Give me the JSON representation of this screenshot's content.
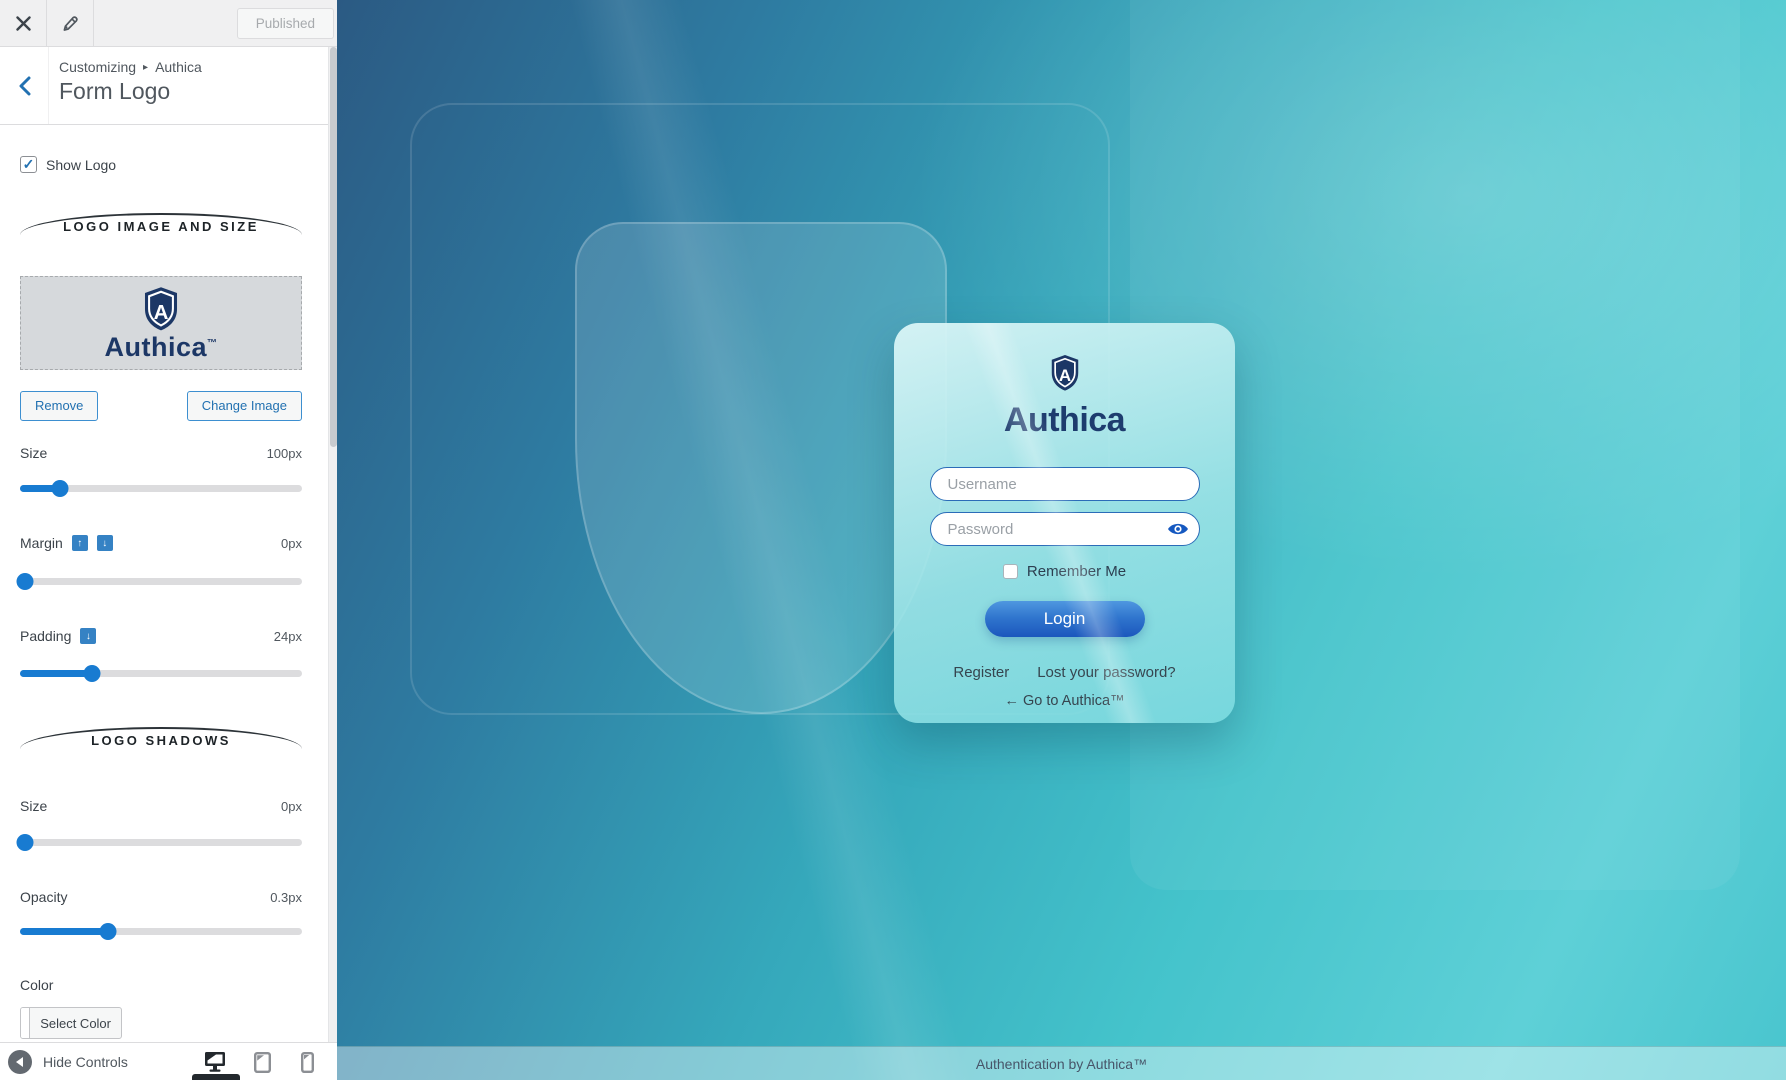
{
  "customizer": {
    "topbar": {
      "publish_label": "Published"
    },
    "header": {
      "breadcrumb": {
        "part1": "Customizing",
        "separator": "▸",
        "part2": "Authica"
      },
      "title": "Form Logo"
    },
    "show_logo": {
      "label": "Show Logo",
      "checkmark": "✓"
    },
    "sections": {
      "image_size": "LOGO IMAGE AND SIZE",
      "shadows": "LOGO SHADOWS"
    },
    "logo_preview": {
      "brand": "Authica",
      "tm": "™"
    },
    "buttons": {
      "remove": "Remove",
      "change_image": "Change Image"
    },
    "icons": {
      "up_arrow": "↑",
      "down_arrow": "↓"
    },
    "controls": {
      "size": {
        "label": "Size",
        "value": "100px",
        "percent": 14
      },
      "margin": {
        "label": "Margin",
        "value": "0px",
        "percent": 1.5
      },
      "padding": {
        "label": "Padding",
        "value": "24px",
        "percent": 25
      },
      "shadow_size": {
        "label": "Size",
        "value": "0px",
        "percent": 1.5
      },
      "shadow_opacity": {
        "label": "Opacity",
        "value": "0.3px",
        "percent": 31
      },
      "color": {
        "label": "Color",
        "button": "Select Color"
      }
    },
    "bottombar": {
      "hide_controls": "Hide Controls"
    }
  },
  "preview": {
    "login_card": {
      "brand": "Authica",
      "username_placeholder": "Username",
      "password_placeholder": "Password",
      "remember_label": "Remember Me",
      "login_label": "Login",
      "register_label": "Register",
      "lost_password_label": "Lost your password?",
      "back_link": "← Go to Authica™"
    },
    "footer": "Authentication by Authica™"
  },
  "colors": {
    "wp_accent_blue": "#2271b1",
    "slider_blue": "#187bd1",
    "logo_navy": "#1c3766",
    "login_button_blue": "#1b57bd",
    "preview_teal": "#44c3cb",
    "preview_dark_blue": "#2b5a83"
  }
}
